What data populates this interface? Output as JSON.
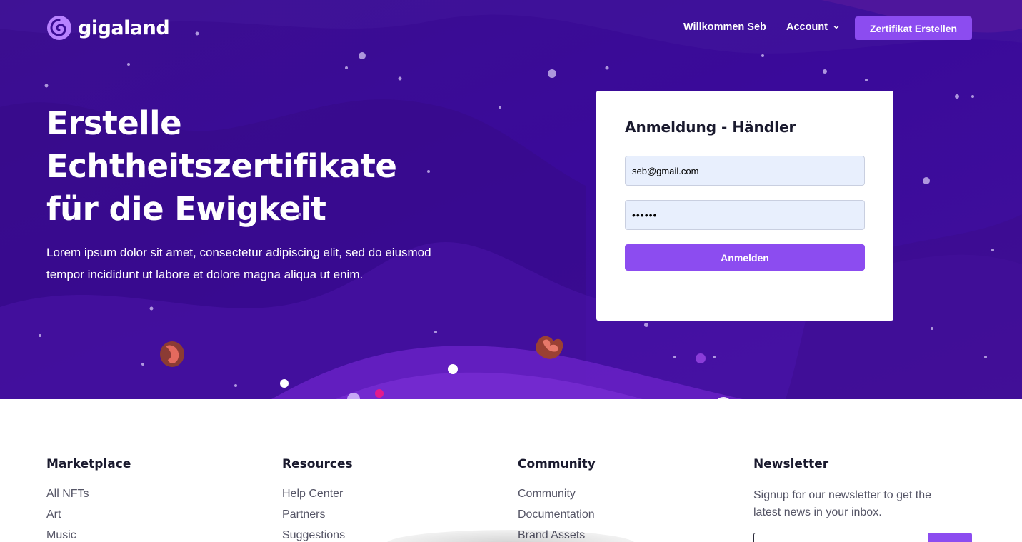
{
  "colors": {
    "hero_bg": "#3a0c95",
    "accent": "#8c4cf0",
    "card_bg": "#ffffff",
    "input_bg": "#e8effd"
  },
  "nav": {
    "logo_text": "gigaland",
    "welcome": "Willkommen Seb",
    "account": "Account",
    "cta": "Zertifikat Erstellen"
  },
  "hero": {
    "title_lines": [
      "Erstelle",
      "Echtheitszertifikate",
      "für die Ewigkeit"
    ],
    "description": "Lorem ipsum dolor sit amet, consectetur adipiscing elit, sed do eiusmod tempor incididunt ut labore et dolore magna aliqua ut enim."
  },
  "login": {
    "title": "Anmeldung - Händler",
    "email_value": "seb@gmail.com",
    "password_value": "••••••",
    "submit": "Anmelden"
  },
  "footer": {
    "marketplace": {
      "heading": "Marketplace",
      "links": [
        "All NFTs",
        "Art",
        "Music"
      ]
    },
    "resources": {
      "heading": "Resources",
      "links": [
        "Help Center",
        "Partners",
        "Suggestions"
      ]
    },
    "community": {
      "heading": "Community",
      "links": [
        "Community",
        "Documentation",
        "Brand Assets"
      ]
    },
    "newsletter": {
      "heading": "Newsletter",
      "text": "Signup for our newsletter to get the latest news in your inbox."
    }
  }
}
